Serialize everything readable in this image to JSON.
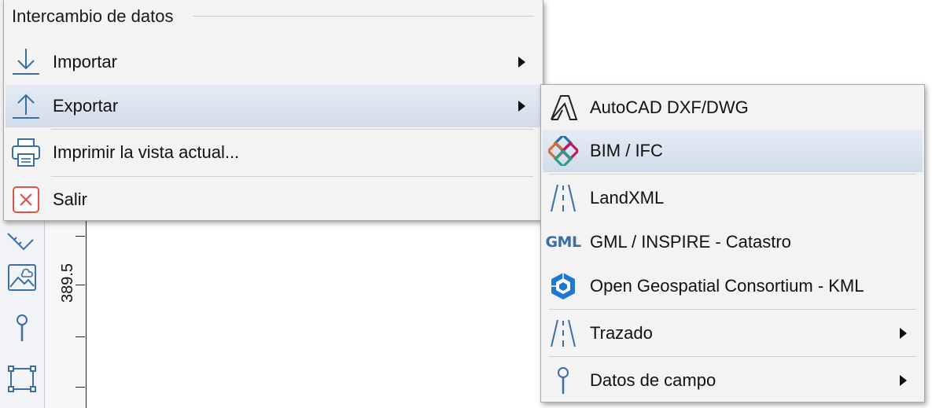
{
  "ruler": {
    "value_label": "389.5"
  },
  "main_menu": {
    "section_title": "Intercambio de datos",
    "items": [
      {
        "label": "Importar",
        "icon": "import-arrow-icon",
        "has_submenu": true
      },
      {
        "label": "Exportar",
        "icon": "export-arrow-icon",
        "has_submenu": true,
        "highlighted": true
      },
      {
        "label": "Imprimir la vista actual...",
        "icon": "printer-icon",
        "has_submenu": false
      },
      {
        "label": "Salir",
        "icon": "exit-icon",
        "has_submenu": false
      }
    ]
  },
  "export_submenu": {
    "items": [
      {
        "label": "AutoCAD DXF/DWG",
        "icon": "autocad-icon",
        "has_submenu": false
      },
      {
        "label": "BIM / IFC",
        "icon": "ifc-icon",
        "has_submenu": false,
        "highlighted": true
      },
      {
        "label": "LandXML",
        "icon": "road-icon",
        "has_submenu": false
      },
      {
        "label": "GML / INSPIRE - Catastro",
        "icon": "gml-icon",
        "icon_text": "GML",
        "has_submenu": false
      },
      {
        "label": "Open Geospatial Consortium - KML",
        "icon": "ogc-icon",
        "has_submenu": false
      },
      {
        "label": "Trazado",
        "icon": "road-icon",
        "has_submenu": true
      },
      {
        "label": "Datos de campo",
        "icon": "pin-icon",
        "has_submenu": true
      }
    ]
  },
  "colors": {
    "accent_blue": "#3a6ea5",
    "exit_red": "#e0524a",
    "highlight": "#d9e2ee"
  }
}
